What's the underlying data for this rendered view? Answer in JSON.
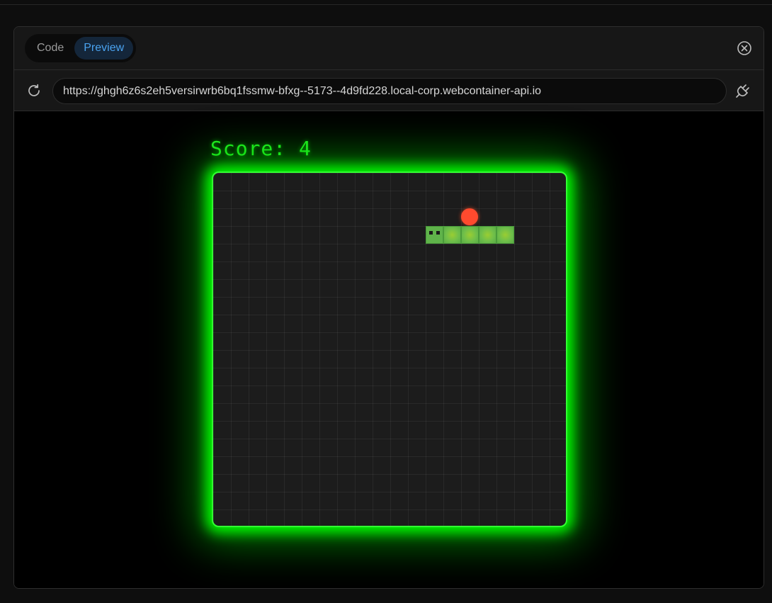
{
  "tabs": [
    {
      "label": "Code",
      "active": false
    },
    {
      "label": "Preview",
      "active": true
    }
  ],
  "address": {
    "url": "https://ghgh6z6s2eh5versirwrb6bq1fssmw-bfxg--5173--4d9fd228.local-corp.webcontainer-api.io"
  },
  "icons": {
    "close": "close-circle-icon",
    "reload": "reload-icon",
    "plug": "plug-icon"
  },
  "game": {
    "score_text": "Score: 4",
    "grid_size": 20,
    "food": {
      "col": 14,
      "row": 2
    },
    "snake": [
      {
        "col": 12,
        "row": 3
      },
      {
        "col": 13,
        "row": 3
      },
      {
        "col": 14,
        "row": 3
      },
      {
        "col": 15,
        "row": 3
      },
      {
        "col": 16,
        "row": 3
      }
    ],
    "direction": "left"
  },
  "colors": {
    "accent_tab": "#4aa3f0",
    "neon_green": "#00ff00",
    "food": "#ff4a2e",
    "snake": "#6fbf4a"
  }
}
